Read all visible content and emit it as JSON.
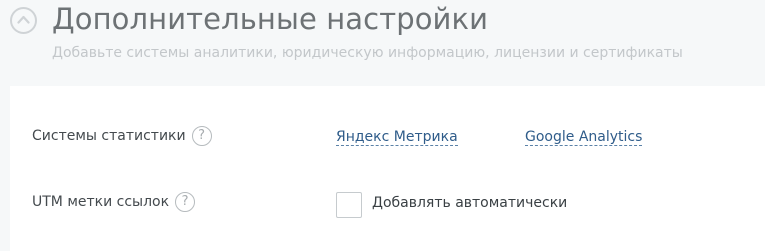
{
  "section": {
    "title": "Дополнительные настройки",
    "subtitle": "Добавьте системы аналитики, юридическую информацию, лицензии и сертификаты"
  },
  "stats_row": {
    "label": "Системы статистики",
    "help": "?",
    "links": [
      "Яндекс Метрика",
      "Google Analytics"
    ]
  },
  "utm_row": {
    "label": "UTM метки ссылок",
    "help": "?",
    "checkbox_label": "Добавлять автоматически",
    "checked": false
  }
}
